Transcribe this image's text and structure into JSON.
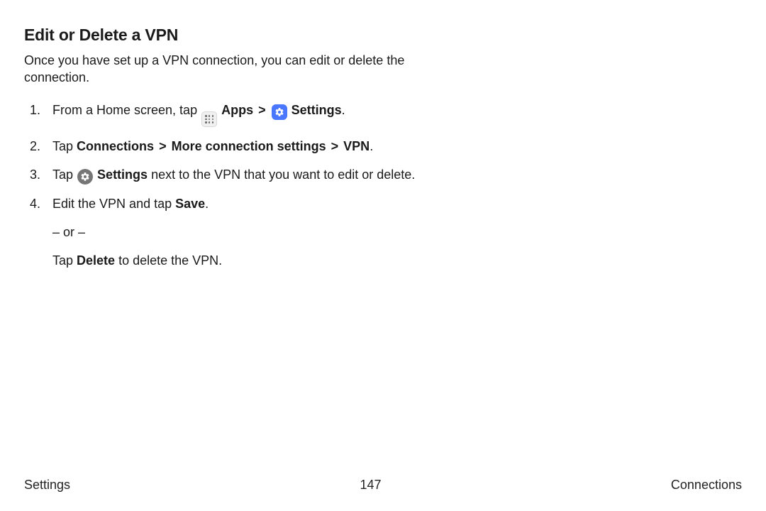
{
  "heading": "Edit or Delete a VPN",
  "intro": "Once you have set up a VPN connection, you can edit or delete the connection.",
  "steps": {
    "s1": {
      "pre": "From a Home screen, tap ",
      "apps": "Apps",
      "chev": ">",
      "settings": "Settings",
      "post": "."
    },
    "s2": {
      "pre": "Tap ",
      "a": "Connections",
      "chev1": ">",
      "b": "More connection settings",
      "chev2": ">",
      "c": "VPN",
      "post": "."
    },
    "s3": {
      "pre": "Tap ",
      "settings": "Settings",
      "post": " next to the VPN that you want to edit or delete."
    },
    "s4": {
      "pre": "Edit the VPN and tap ",
      "save": "Save",
      "post": "."
    },
    "or": "– or –",
    "s5": {
      "pre": "Tap ",
      "del": "Delete",
      "post": " to delete the VPN."
    }
  },
  "footer": {
    "left": "Settings",
    "center": "147",
    "right": "Connections"
  }
}
